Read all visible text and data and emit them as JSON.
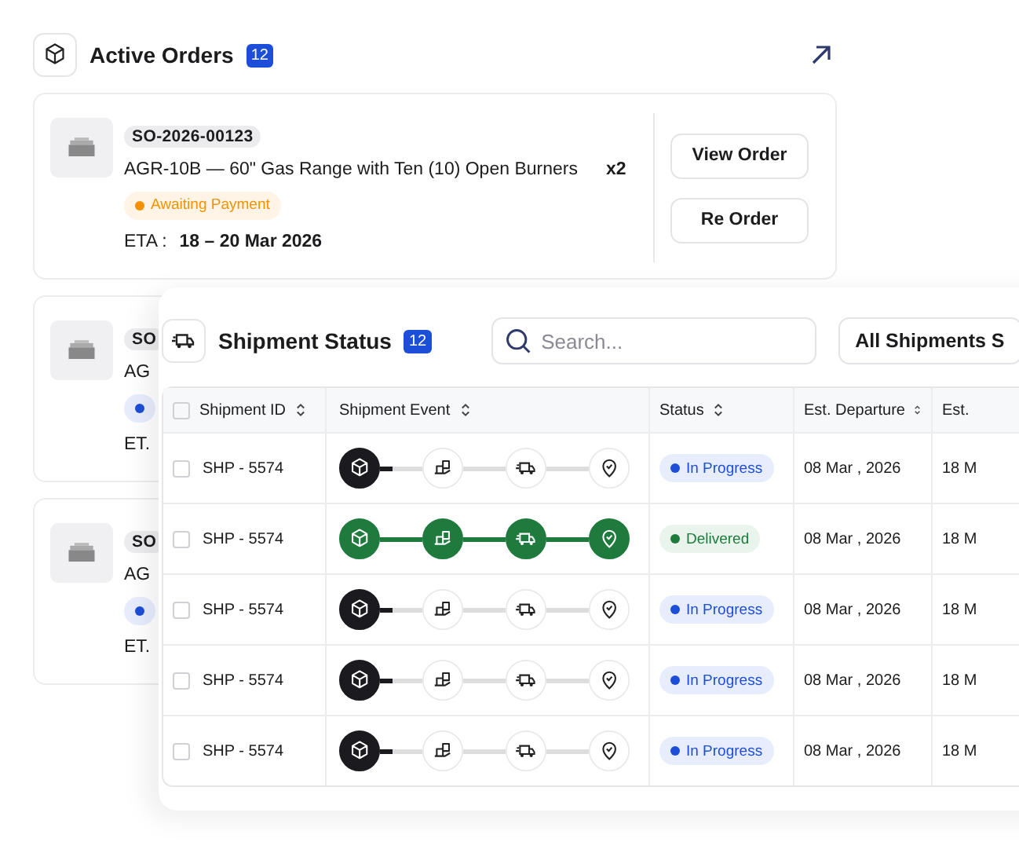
{
  "header": {
    "title": "Active Orders",
    "count": "12"
  },
  "orders": [
    {
      "order_id": "SO-2026-00123",
      "product": "AGR-10B — 60\" Gas Range with Ten (10) Open Burners",
      "quantity": "x2",
      "status": {
        "kind": "awaiting",
        "label": "Awaiting Payment"
      },
      "eta_label": "ETA :",
      "eta": "18 – 20 Mar 2026",
      "actions": [
        "View Order",
        "Re Order"
      ]
    },
    {
      "order_id": "SO",
      "product": "AG",
      "status": {
        "kind": "in_progress"
      },
      "eta_label": "ET."
    },
    {
      "order_id": "SO",
      "product": "AG",
      "status": {
        "kind": "in_progress"
      },
      "eta_label": "ET."
    }
  ],
  "shipments": {
    "title": "Shipment Status",
    "count": "12",
    "search": {
      "placeholder": "Search..."
    },
    "filter": "All Shipments S",
    "columns": [
      {
        "label": "Shipment ID",
        "checked": false
      },
      {
        "label": "Shipment Event"
      },
      {
        "label": "Status"
      },
      {
        "label": "Est. Departure"
      },
      {
        "label": "Est."
      }
    ],
    "rows": [
      {
        "checked": false,
        "id": "SHP - 5574",
        "event": {
          "steps": [
            {
              "done": true
            },
            {
              "done": false
            },
            {
              "done": false
            },
            {
              "done": false
            }
          ]
        },
        "status": {
          "kind": "in_progress",
          "label": "In Progress"
        },
        "departure": "08 Mar , 2026",
        "column_5": "18 M"
      },
      {
        "checked": false,
        "id": "SHP - 5574",
        "event": {
          "steps": [
            {
              "done": true
            },
            {
              "done": true
            },
            {
              "done": true
            },
            {
              "done": true
            }
          ]
        },
        "status": {
          "kind": "delivered",
          "label": "Delivered"
        },
        "departure": "08 Mar , 2026",
        "column_5": "18 M"
      },
      {
        "checked": false,
        "id": "SHP - 5574",
        "event": {
          "steps": [
            {
              "done": true
            },
            {
              "done": false
            },
            {
              "done": false
            },
            {
              "done": false
            }
          ]
        },
        "status": {
          "kind": "in_progress",
          "label": "In Progress"
        },
        "departure": "08 Mar , 2026",
        "column_5": "18 M"
      },
      {
        "checked": false,
        "id": "SHP - 5574",
        "event": {
          "steps": [
            {
              "done": true
            },
            {
              "done": false
            },
            {
              "done": false
            },
            {
              "done": false
            }
          ]
        },
        "status": {
          "kind": "in_progress",
          "label": "In Progress"
        },
        "departure": "08 Mar , 2026",
        "column_5": "18 M"
      },
      {
        "checked": false,
        "id": "SHP - 5574",
        "event": {
          "steps": [
            {
              "done": true
            },
            {
              "done": false
            },
            {
              "done": false
            },
            {
              "done": false
            }
          ]
        },
        "status": {
          "kind": "in_progress",
          "label": "In Progress"
        },
        "departure": "08 Mar , 2026",
        "column_5": "18 M"
      }
    ]
  }
}
